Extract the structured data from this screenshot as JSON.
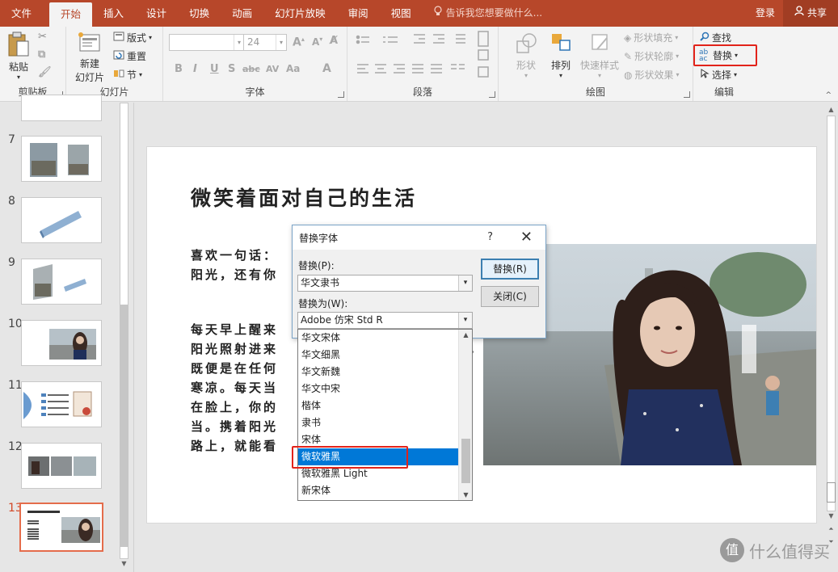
{
  "menu": {
    "tabs": [
      "文件",
      "开始",
      "插入",
      "设计",
      "切换",
      "动画",
      "幻灯片放映",
      "审阅",
      "视图"
    ],
    "tell_me": "告诉我您想要做什么...",
    "login": "登录",
    "share": "共享"
  },
  "ribbon": {
    "clipboard": {
      "label": "剪贴板",
      "paste": "粘贴"
    },
    "slides": {
      "label": "幻灯片",
      "new_slide": "新建\n幻灯片",
      "new_slide_line1": "新建",
      "new_slide_line2": "幻灯片",
      "layout": "版式",
      "reset": "重置",
      "section": "节"
    },
    "font": {
      "label": "字体",
      "font_name": "",
      "font_size": "24",
      "bold": "B",
      "italic": "I",
      "underline": "U",
      "shadow": "S",
      "strike": "abc",
      "spacing": "AV",
      "case": "Aa",
      "color": "A"
    },
    "paragraph": {
      "label": "段落"
    },
    "drawing": {
      "label": "绘图",
      "shapes": "形状",
      "arrange": "排列",
      "quick_styles": "快速样式",
      "fill": "形状填充",
      "outline": "形状轮廓",
      "effects": "形状效果"
    },
    "editing": {
      "label": "编辑",
      "find": "查找",
      "replace": "替换",
      "select": "选择"
    }
  },
  "thumbnails": {
    "numbers": [
      "7",
      "8",
      "9",
      "10",
      "11",
      "12",
      "13"
    ],
    "active": "13"
  },
  "slide": {
    "title": "微笑着面对自己的生活",
    "para1_line1": "喜欢一句话：",
    "para1_line2": "阳光，还有你",
    "para2_line1": "每天早上醒来",
    "para2_line2": "阳光照射进来",
    "para2_line3": "既便是在任何",
    "para2_line4": "寒凉。每天当",
    "para2_line5": "在脸上，你的",
    "para2_line6": "当。携着阳光",
    "para2_line7": "路上，就能看",
    "comma": ","
  },
  "dialog": {
    "title": "替换字体",
    "help": "?",
    "replace_label": "替换(P):",
    "replace_value": "华文隶书",
    "with_label": "替换为(W):",
    "with_value": "Adobe 仿宋 Std R",
    "replace_button": "替换(R)",
    "close_button": "关闭(C)"
  },
  "font_list": {
    "items": [
      "华文宋体",
      "华文细黑",
      "华文新魏",
      "华文中宋",
      "楷体",
      "隶书",
      "宋体",
      "微软雅黑",
      "微软雅黑 Light",
      "新宋体"
    ],
    "selected": "微软雅黑"
  },
  "watermark": {
    "text": "什么值得买",
    "logo": "值"
  },
  "colors": {
    "accent": "#b7472a",
    "selection": "#0078d7",
    "highlight": "#e2231a"
  }
}
